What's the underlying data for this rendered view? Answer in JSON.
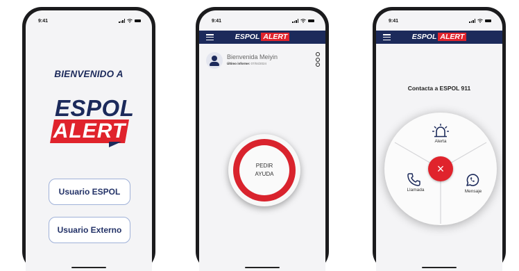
{
  "phone1": {
    "status_time": "9:41",
    "welcome": "BIENVENIDO A",
    "logo_line1": "ESPOL",
    "logo_line2": "ALERT",
    "btn_espol": "Usuario ESPOL",
    "btn_externo": "Usuario Externo"
  },
  "phone2": {
    "status_time": "9:41",
    "brand_a": "ESPOL",
    "brand_b": "ALERT",
    "user_name": "Bienvenida Meiyin",
    "report_label": "Último informe:",
    "report_date": "07/04/2024",
    "sos_line1": "PEDIR",
    "sos_line2": "AYUDA"
  },
  "phone3": {
    "status_time": "9:41",
    "brand_a": "ESPOL",
    "brand_b": "ALERT",
    "title": "Contacta a ESPOL 911",
    "alerta": "Alerta",
    "llamada": "Llamada",
    "mensaje": "Mensaje",
    "close_glyph": "×"
  },
  "colors": {
    "navy": "#1c2a5b",
    "red": "#e0232c"
  }
}
